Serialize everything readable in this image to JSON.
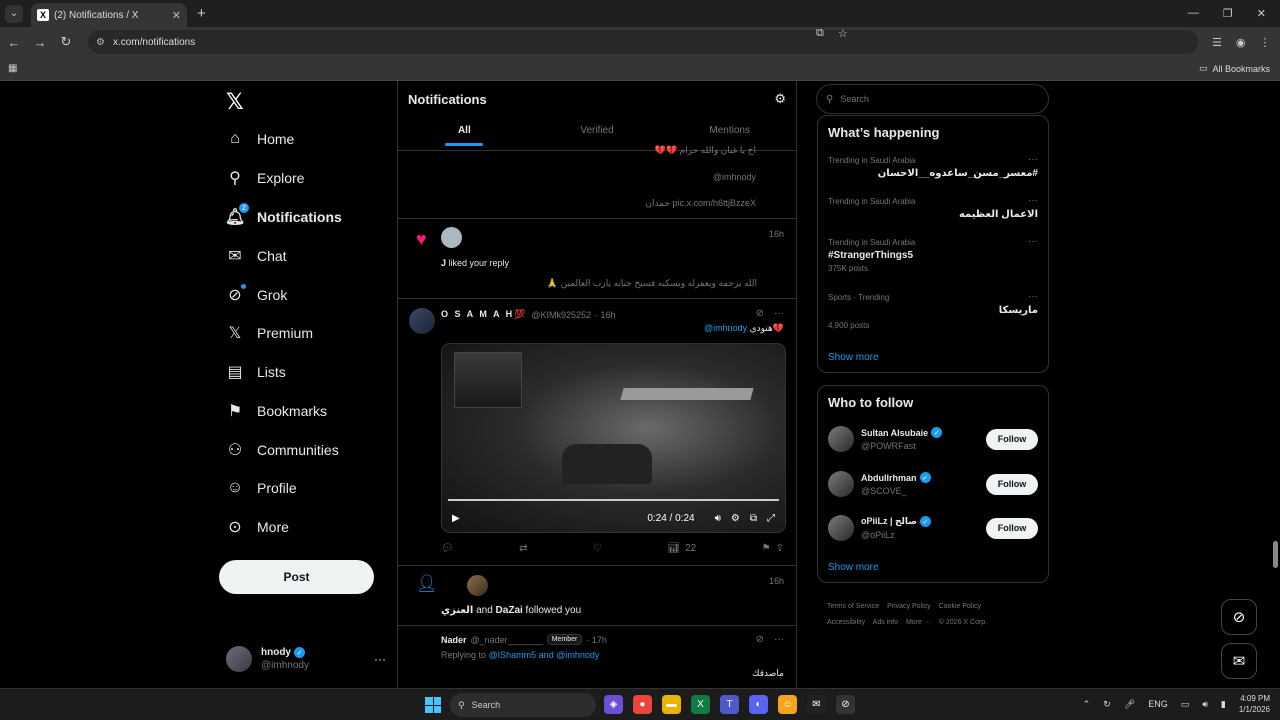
{
  "browser": {
    "tab_title": "(2) Notifications / X",
    "url": "x.com/notifications",
    "all_bookmarks": "All Bookmarks"
  },
  "nav": {
    "items": [
      {
        "label": "Home",
        "icon": "home-icon"
      },
      {
        "label": "Explore",
        "icon": "search-icon"
      },
      {
        "label": "Notifications",
        "icon": "bell-icon",
        "badge": "2"
      },
      {
        "label": "Chat",
        "icon": "mail-icon"
      },
      {
        "label": "Grok",
        "icon": "grok-icon"
      },
      {
        "label": "Premium",
        "icon": "x-icon"
      },
      {
        "label": "Lists",
        "icon": "list-icon"
      },
      {
        "label": "Bookmarks",
        "icon": "bookmark-icon"
      },
      {
        "label": "Communities",
        "icon": "people-icon"
      },
      {
        "label": "Profile",
        "icon": "person-icon"
      },
      {
        "label": "More",
        "icon": "more-circle-icon"
      }
    ],
    "post_label": "Post",
    "account_name": "hnody",
    "account_handle": "@imhnody"
  },
  "main": {
    "title": "Notifications",
    "tabs": [
      "All",
      "Verified",
      "Mentions"
    ],
    "item1": {
      "line1": "اخ يا غبان والله حرام 💔💔",
      "line2": "@imhnody",
      "line3": "حمدان pic.x.com/h6ttjBzzeX"
    },
    "item2": {
      "liker": "J",
      "action": " liked your reply",
      "time": "16h",
      "quote": "الله يرحمه ويغفرله ويسكنه فسيح جناته يارب العالمين 🙏"
    },
    "item3": {
      "name": "O S A M A H💯",
      "handle": "@KIMk925252",
      "time": "· 16h",
      "body_text": "هنودي💔",
      "body_mention": "@imhnody",
      "video_time": "0:24 / 0:24",
      "views": "22"
    },
    "item4": {
      "user1": "العنزي",
      "and": " and ",
      "user2": "DaZai",
      "action": " followed you",
      "time": "16h"
    },
    "item5": {
      "name": "Nader",
      "handle": "@_nader_______",
      "member": "Member",
      "time": "· 17h",
      "replying": "Replying to ",
      "mentions": "@IShamm5 and @imhnody",
      "body": "ماصدقك"
    }
  },
  "sidebar": {
    "search_placeholder": "Search",
    "happening_title": "What’s happening",
    "trends": [
      {
        "context": "Trending in Saudi Arabia",
        "title": "#معسر_مسن_ساعدوه__الاحسان",
        "posts": ""
      },
      {
        "context": "Trending in Saudi Arabia",
        "title": "الاعمال العظيمه",
        "posts": ""
      },
      {
        "context": "Trending in Saudi Arabia",
        "title": "#StrangerThings5",
        "posts": "375K posts"
      },
      {
        "context": "Sports · Trending",
        "title": "ماريسكا",
        "posts": "4,900 posts"
      }
    ],
    "show_more": "Show more",
    "wtf_title": "Who to follow",
    "follow": [
      {
        "name": "Sultan Alsubaie",
        "handle": "@POWRFast"
      },
      {
        "name": "Abdullrhman",
        "handle": "@SCOVE_"
      },
      {
        "name": "oPiiLz | صالح",
        "handle": "@oPiiLz"
      }
    ],
    "follow_label": "Follow",
    "footer": [
      "Terms of Service",
      "Privacy Policy",
      "Cookie Policy",
      "Accessibility",
      "Ads info",
      "More ···",
      "© 2026 X Corp."
    ]
  },
  "taskbar": {
    "search": "Search",
    "lang": "ENG",
    "time": "4:09 PM",
    "date": "1/1/2026"
  }
}
